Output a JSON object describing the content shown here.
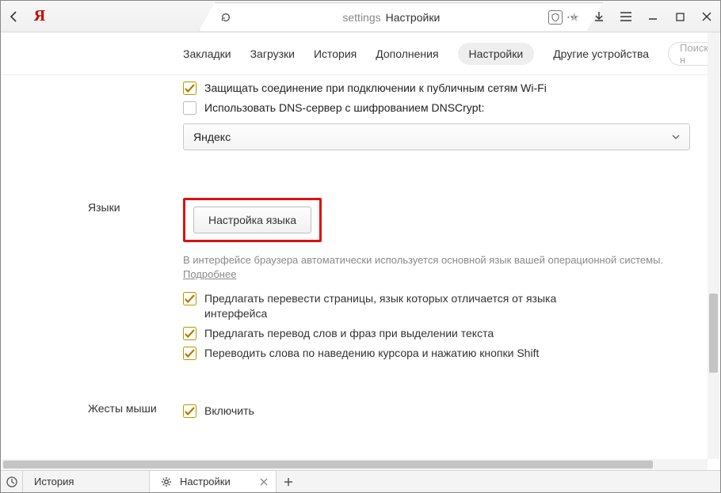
{
  "address": {
    "path": "settings",
    "title": "Настройки"
  },
  "logo": "Я",
  "nav": {
    "items": [
      {
        "label": "Закладки"
      },
      {
        "label": "Загрузки"
      },
      {
        "label": "История"
      },
      {
        "label": "Дополнения"
      },
      {
        "label": "Настройки",
        "active": true
      },
      {
        "label": "Другие устройства"
      }
    ],
    "search_placeholder": "Поиск н"
  },
  "security": {
    "protect_label": "Защищать соединение при подключении к публичным сетям Wi-Fi",
    "dnscrypt_label": "Использовать DNS-сервер с шифрованием DNSCrypt:",
    "dns_select_value": "Яндекс"
  },
  "languages": {
    "section_label": "Языки",
    "config_button": "Настройка языка",
    "note_text": "В интерфейсе браузера автоматически используется основной язык вашей операционной системы. ",
    "note_link": "Подробнее",
    "cb1": "Предлагать перевести страницы, язык которых отличается от языка интерфейса",
    "cb2": "Предлагать перевод слов и фраз при выделении текста",
    "cb3": "Переводить слова по наведению курсора и нажатию кнопки Shift"
  },
  "mouse": {
    "section_label": "Жесты мыши",
    "cb_enable": "Включить"
  },
  "bottom_tabs": {
    "history": "История",
    "settings": "Настройки"
  }
}
